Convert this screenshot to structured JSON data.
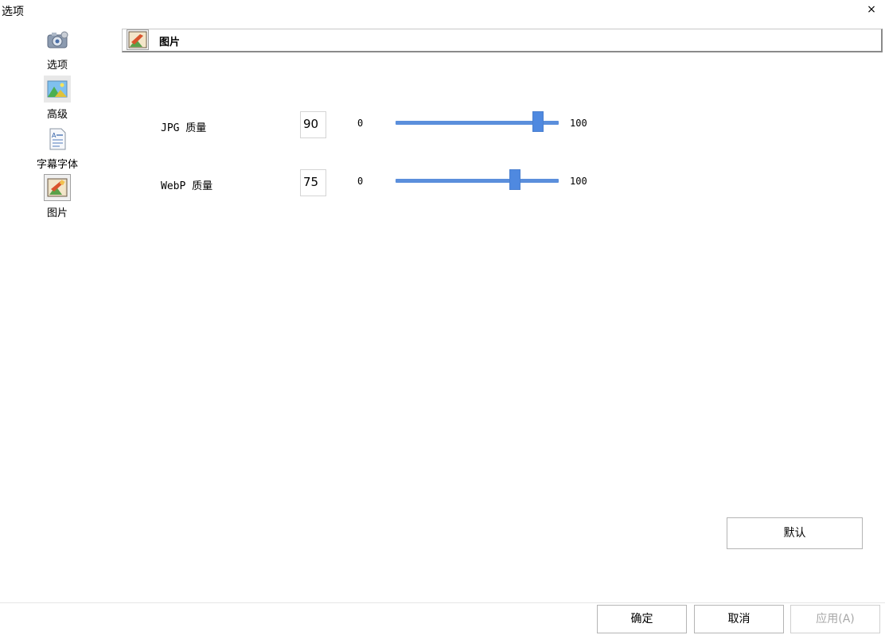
{
  "window": {
    "title": "选项",
    "close_glyph": "×"
  },
  "sidebar": {
    "items": [
      {
        "label": "选项",
        "icon": "settings-gear-camera-icon"
      },
      {
        "label": "高级",
        "icon": "landscape-picture-icon"
      },
      {
        "label": "字幕字体",
        "icon": "document-text-icon"
      },
      {
        "label": "图片",
        "icon": "image-brush-icon",
        "selected": true
      }
    ]
  },
  "section": {
    "title": "图片",
    "icon": "image-brush-icon"
  },
  "settings": {
    "jpg": {
      "label": "JPG 质量",
      "value": "90",
      "min": "0",
      "max": "100",
      "level": 90
    },
    "webp": {
      "label": "WebP 质量",
      "value": "75",
      "min": "0",
      "max": "100",
      "level": 75
    }
  },
  "buttons": {
    "default": "默认",
    "ok": "确定",
    "cancel": "取消",
    "apply": "应用(A)"
  }
}
